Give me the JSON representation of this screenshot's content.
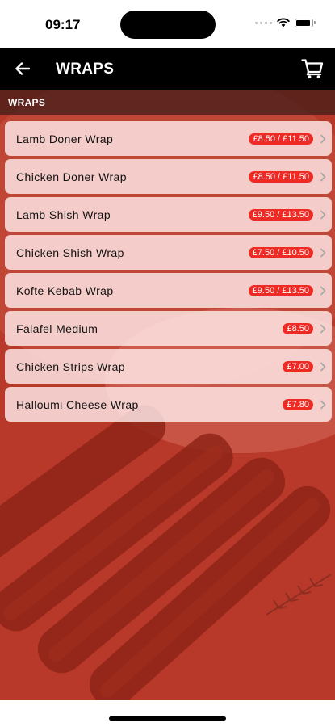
{
  "status_bar": {
    "time": "09:17"
  },
  "header": {
    "title": "WRAPS"
  },
  "section": {
    "label": "WRAPS"
  },
  "menu": {
    "items": [
      {
        "name": "Lamb Doner Wrap",
        "price": "£8.50 / £11.50"
      },
      {
        "name": "Chicken Doner Wrap",
        "price": "£8.50 / £11.50"
      },
      {
        "name": "Lamb Shish Wrap",
        "price": "£9.50 / £13.50"
      },
      {
        "name": "Chicken Shish Wrap",
        "price": "£7.50 / £10.50"
      },
      {
        "name": "Kofte Kebab Wrap",
        "price": "£9.50 / £13.50"
      },
      {
        "name": "Falafel Medium",
        "price": "£8.50"
      },
      {
        "name": "Chicken Strips Wrap",
        "price": "£7.00"
      },
      {
        "name": "Halloumi Cheese Wrap",
        "price": "£7.80"
      }
    ]
  },
  "icons": {
    "back": "arrow-left-icon",
    "cart": "shopping-cart-icon",
    "chevron": "chevron-right-icon"
  },
  "colors": {
    "nav_background": "#000000",
    "price_badge": "#ee2a24",
    "backdrop": "#b83a2a"
  }
}
